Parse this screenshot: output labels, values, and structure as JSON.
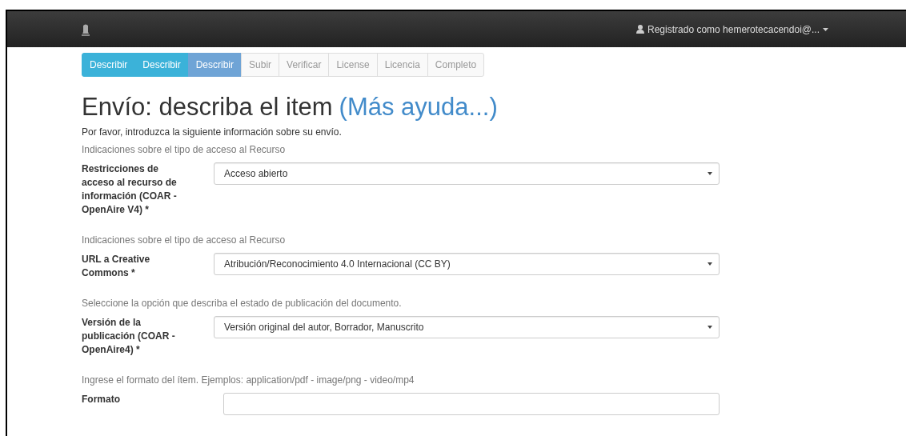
{
  "navbar": {
    "user": "Registrado como hemerotecacendoi@..."
  },
  "steps": [
    {
      "label": "Describir",
      "completed": true,
      "selected": false
    },
    {
      "label": "Describir",
      "completed": true,
      "selected": false
    },
    {
      "label": "Describir",
      "completed": false,
      "selected": true
    },
    {
      "label": "Subir",
      "completed": false,
      "selected": false
    },
    {
      "label": "Verificar",
      "completed": false,
      "selected": false
    },
    {
      "label": "License",
      "completed": false,
      "selected": false
    },
    {
      "label": "Licencia",
      "completed": false,
      "selected": false
    },
    {
      "label": "Completo",
      "completed": false,
      "selected": false
    }
  ],
  "title": "Envío: describa el item",
  "help_link": "(Más ayuda...)",
  "intro": "Por favor, introduzca la siguiente información sobre su envío.",
  "fields": [
    {
      "hint": "Indicaciones sobre el tipo de acceso al Recurso",
      "label": "Restricciones de acceso al recurso de información (COAR - OpenAire V4) *",
      "kind": "select",
      "value": "Acceso abierto"
    },
    {
      "hint": "Indicaciones sobre el tipo de acceso al Recurso",
      "label": "URL a Creative Commons *",
      "kind": "select",
      "value": "Atribución/Reconocimiento 4.0 Internacional (CC BY)"
    },
    {
      "hint": "Seleccione la opción que describa el estado de publicación del documento.",
      "label": "Versión de la publicación (COAR - OpenAire4) *",
      "kind": "select",
      "value": "Versión original del autor, Borrador, Manuscrito"
    },
    {
      "hint": "Ingrese el formato del ítem. Ejemplos: application/pdf - image/png - video/mp4",
      "label": "Formato",
      "kind": "text"
    }
  ]
}
